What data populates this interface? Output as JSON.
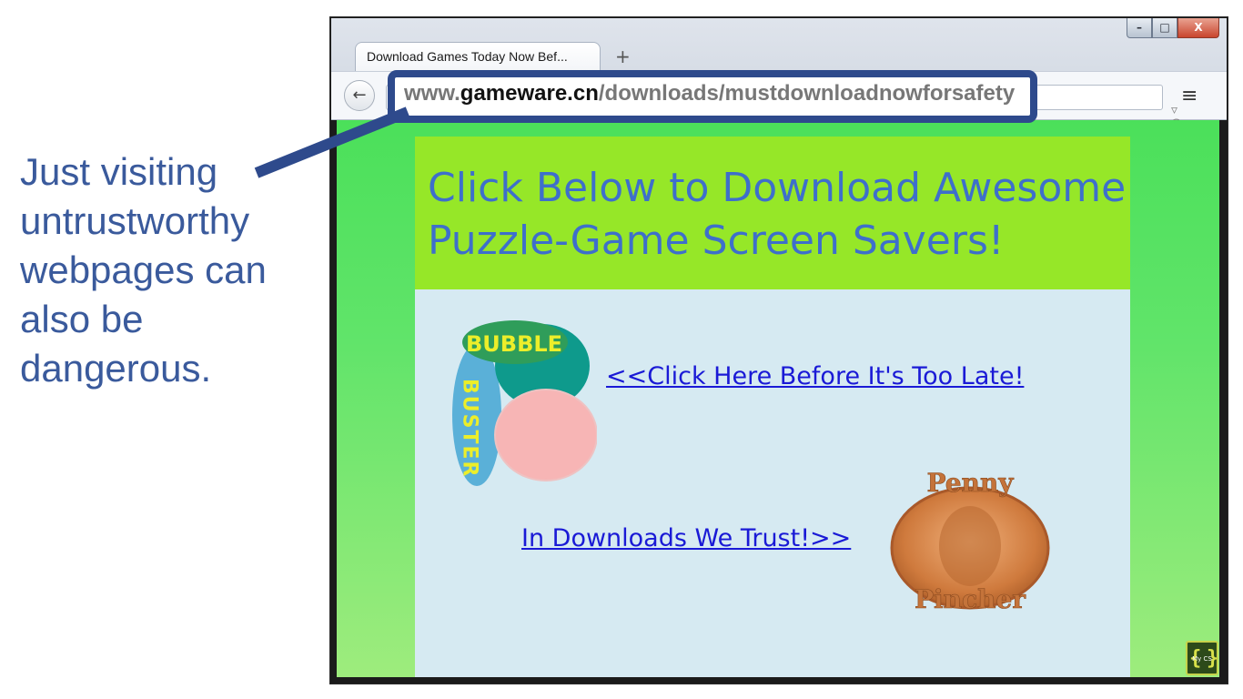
{
  "caption": {
    "lines": [
      "Just visiting",
      "untrustworthy",
      "webpages can",
      "also be",
      "dangerous."
    ]
  },
  "browser": {
    "tab_title": "Download Games Today Now Bef...",
    "new_tab_symbol": "+",
    "back_symbol": "←",
    "url_prefix": "www.",
    "url_domain": "gameware.cn",
    "url_path": "/downloads/mustdownloadnowforsafety",
    "url_actions": "▿ C",
    "menu_symbol": "≡",
    "window_controls": {
      "minimize": "–",
      "maximize": "□",
      "close": "X"
    }
  },
  "page": {
    "heading": "Click Below to Download Awesome Puzzle-Game Screen Savers!",
    "link1": "<<Click Here Before It's Too Late!",
    "link2": "In Downloads We Trust!>>",
    "logo1": {
      "word1": "BUBBLE",
      "word2": "BUSTER"
    },
    "logo2": {
      "top": "Penny",
      "bottom": "Pincher"
    }
  },
  "badge": {
    "text": "My CS"
  },
  "colors": {
    "caption": "#3a5a9c",
    "highlight_border": "#2e4a8c",
    "page_green": "#4be05a",
    "header_green": "#96e728",
    "body_blue": "#d6eaf2",
    "heading_blue": "#3e6fcb",
    "link_blue": "#1a1ad6",
    "penny_copper": "#c4733a"
  }
}
